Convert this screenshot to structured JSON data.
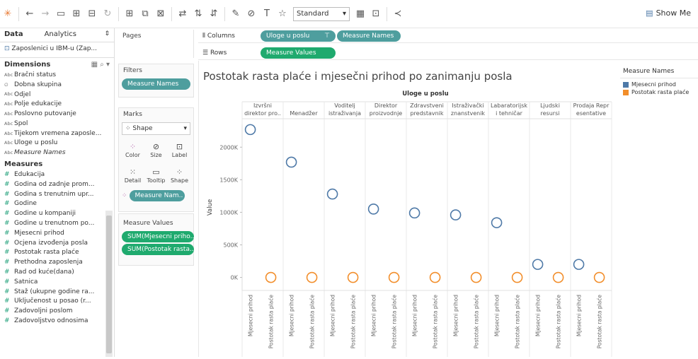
{
  "toolbar": {
    "mark_type_select": "Standard",
    "show_me_label": "Show Me"
  },
  "left_pane": {
    "tab_data": "Data",
    "tab_analytics": "Analytics",
    "datasource": "Zaposlenici u IBM-u (Zap...",
    "dimensions_label": "Dimensions",
    "dimensions": [
      {
        "type": "Abc",
        "name": "Bračni status"
      },
      {
        "type": "∅",
        "name": "Dobna skupina"
      },
      {
        "type": "Abc",
        "name": "Odjel"
      },
      {
        "type": "Abc",
        "name": "Polje edukacije"
      },
      {
        "type": "Abc",
        "name": "Poslovno putovanje"
      },
      {
        "type": "Abc",
        "name": "Spol"
      },
      {
        "type": "Abc",
        "name": "Tijekom vremena zaposle..."
      },
      {
        "type": "Abc",
        "name": "Uloge u poslu"
      },
      {
        "type": "Abc",
        "name": "Measure Names"
      }
    ],
    "measures_label": "Measures",
    "measures": [
      "Edukacija",
      "Godina od zadnje prom...",
      "Godina s trenutnim upr...",
      "Godine",
      "Godine u kompaniji",
      "Godine u trenutnom po...",
      "Mjesecni prihod",
      "Ocjena izvođenja posla",
      "Postotak rasta plaće",
      "Prethodna zaposlenja",
      "Rad od kuće(dana)",
      "Satnica",
      "Staž (ukupne godine ra...",
      "Uključenost u posao (r...",
      "Zadovoljni poslom",
      "Zadovoljstvo odnosima"
    ]
  },
  "cards": {
    "pages": "Pages",
    "filters": "Filters",
    "filter_pill": "Measure Names",
    "marks": "Marks",
    "marks_type": "Shape",
    "mark_buttons": [
      "Color",
      "Size",
      "Label",
      "Detail",
      "Tooltip",
      "Shape"
    ],
    "marks_pill": "Measure Nam..",
    "measure_values": "Measure Values",
    "mv_pills": [
      "SUM(Mjesecni priho...",
      "SUM(Postotak rasta..."
    ]
  },
  "shelves": {
    "columns_label": "Columns",
    "rows_label": "Rows",
    "columns_pills": [
      "Uloge u poslu",
      "Measure Names"
    ],
    "rows_pills": [
      "Measure Values"
    ]
  },
  "viz": {
    "title": "Postotak rasta plaće i mjesečni prihod po zanimanju posla"
  },
  "legend": {
    "title": "Measure Names",
    "items": [
      {
        "label": "Mjesecni prihod",
        "color": "#4e79a7"
      },
      {
        "label": "Postotak rasta plaće",
        "color": "#f28e2b"
      }
    ]
  },
  "chart_data": {
    "type": "scatter",
    "title": "Postotak rasta plaće i mjesečni prihod po zanimanju posla",
    "column_header": "Uloge u poslu",
    "ylabel": "Value",
    "ylim": [
      -200000,
      2350000
    ],
    "yticks": [
      0,
      500000,
      1000000,
      1500000,
      2000000
    ],
    "ytick_labels": [
      "0K",
      "500K",
      "1000K",
      "1500K",
      "2000K"
    ],
    "categories": [
      [
        "Izvršni",
        "direktor pro.."
      ],
      [
        "Menadžer"
      ],
      [
        "Voditelj",
        "istraživanja"
      ],
      [
        "Direktor",
        "proizvodnje"
      ],
      [
        "Zdravstveni",
        "predstavnik"
      ],
      [
        "Istraživački",
        "znanstvenik"
      ],
      [
        "Labaratorijsk",
        "i tehničar"
      ],
      [
        "Ljudski",
        "resursi"
      ],
      [
        "Prodaja Repr",
        "esentative"
      ]
    ],
    "subcolumns": [
      "Mjesecni prihod",
      "Postotak rasta plaće"
    ],
    "series": [
      {
        "name": "Mjesecni prihod",
        "color": "#4e79a7",
        "values": [
          2270000,
          1770000,
          1280000,
          1050000,
          990000,
          960000,
          840000,
          200000,
          200000
        ]
      },
      {
        "name": "Postotak rasta plaće",
        "color": "#f28e2b",
        "values": [
          0,
          0,
          0,
          0,
          0,
          0,
          0,
          0,
          0
        ]
      }
    ],
    "grid": false,
    "legend": "right"
  }
}
